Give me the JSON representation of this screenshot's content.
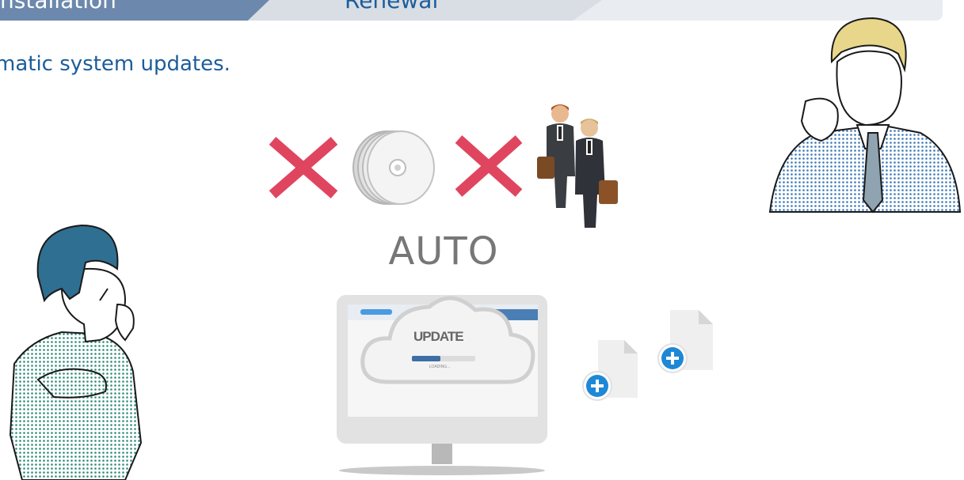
{
  "tabs": [
    {
      "label": "w Installation",
      "active": true
    },
    {
      "label": "Renewal",
      "active": false
    }
  ],
  "tagline": "matic system updates.",
  "auto_label": "AUTO",
  "update_screen": {
    "title": "UPDATE",
    "status": "LOADING..."
  },
  "icons": [
    "cross-icon",
    "disc-stack-icon",
    "cross-icon",
    "businessmen-icon",
    "monitor-icon",
    "cloud-icon",
    "new-file-icon",
    "new-file-icon"
  ],
  "colors": {
    "tab_active": "#6c88ad",
    "tab_track": "#e9ecf0",
    "text_blue": "#1c5d9a",
    "cross_red": "#e0455f",
    "plus_blue": "#1e88d6"
  }
}
